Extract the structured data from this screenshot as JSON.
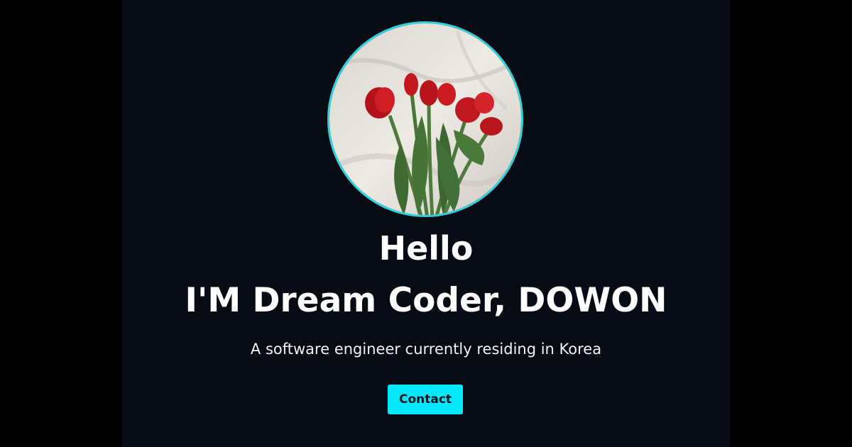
{
  "profile": {
    "greeting": "Hello",
    "name_line": "I'M Dream Coder, DOWON",
    "tagline": "A software engineer currently residing in Korea",
    "avatar_icon": "tulip-bouquet-photo"
  },
  "actions": {
    "contact_label": "Contact"
  },
  "colors": {
    "background": "#060b14",
    "accent": "#03e8f9",
    "avatar_border": "#2fd1dc",
    "text": "#ffffff"
  }
}
